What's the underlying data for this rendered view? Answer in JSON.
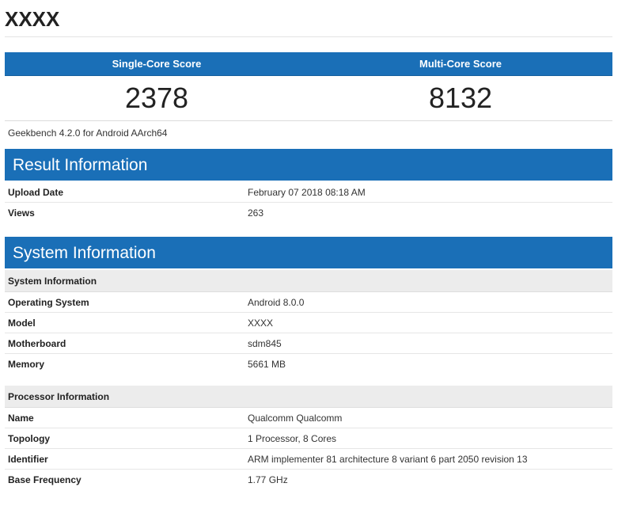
{
  "device": {
    "title": "XXXX"
  },
  "scores": {
    "single_label": "Single-Core Score",
    "multi_label": "Multi-Core Score",
    "single_value": "2378",
    "multi_value": "8132",
    "version": "Geekbench 4.2.0 for Android AArch64"
  },
  "result_info": {
    "title": "Result Information",
    "rows": [
      {
        "key": "Upload Date",
        "value": "February 07 2018 08:18 AM"
      },
      {
        "key": "Views",
        "value": "263"
      }
    ]
  },
  "system_info": {
    "title": "System Information",
    "system_group": {
      "label": "System Information",
      "rows": [
        {
          "key": "Operating System",
          "value": "Android 8.0.0"
        },
        {
          "key": "Model",
          "value": "XXXX"
        },
        {
          "key": "Motherboard",
          "value": "sdm845"
        },
        {
          "key": "Memory",
          "value": "5661 MB"
        }
      ]
    },
    "processor_group": {
      "label": "Processor Information",
      "rows": [
        {
          "key": "Name",
          "value": "Qualcomm Qualcomm"
        },
        {
          "key": "Topology",
          "value": "1 Processor, 8 Cores"
        },
        {
          "key": "Identifier",
          "value": "ARM implementer 81 architecture 8 variant 6 part 2050 revision 13"
        },
        {
          "key": "Base Frequency",
          "value": "1.77 GHz"
        }
      ]
    }
  },
  "colors": {
    "header_blue": "#1a6fb7",
    "group_gray": "#ececec"
  }
}
